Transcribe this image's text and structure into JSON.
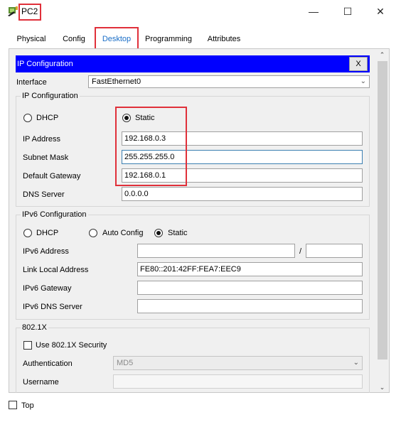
{
  "window": {
    "title": "PC2",
    "minimize_glyph": "—",
    "maximize_glyph": "☐",
    "close_glyph": "✕"
  },
  "tabs": [
    {
      "label": "Physical"
    },
    {
      "label": "Config"
    },
    {
      "label": "Desktop",
      "active": true
    },
    {
      "label": "Programming"
    },
    {
      "label": "Attributes"
    }
  ],
  "panel": {
    "header": "IP Configuration",
    "close_label": "X",
    "interface_label": "Interface",
    "interface_value": "FastEthernet0"
  },
  "ipv4": {
    "group_title": "IP Configuration",
    "dhcp_label": "DHCP",
    "static_label": "Static",
    "mode": "Static",
    "fields": [
      {
        "label": "IP Address",
        "value": "192.168.0.3"
      },
      {
        "label": "Subnet Mask",
        "value": "255.255.255.0"
      },
      {
        "label": "Default Gateway",
        "value": "192.168.0.1"
      },
      {
        "label": "DNS Server",
        "value": "0.0.0.0"
      }
    ]
  },
  "ipv6": {
    "group_title": "IPv6 Configuration",
    "dhcp_label": "DHCP",
    "auto_label": "Auto Config",
    "static_label": "Static",
    "mode": "Static",
    "address_label": "IPv6 Address",
    "address_value": "",
    "prefix_separator": "/",
    "prefix_value": "",
    "link_local_label": "Link Local Address",
    "link_local_value": "FE80::201:42FF:FEA7:EEC9",
    "gateway_label": "IPv6 Gateway",
    "gateway_value": "",
    "dns_label": "IPv6 DNS Server",
    "dns_value": ""
  },
  "dot1x": {
    "group_title": "802.1X",
    "use_security_label": "Use 802.1X Security",
    "use_security_checked": false,
    "auth_label": "Authentication",
    "auth_value": "MD5",
    "username_label": "Username"
  },
  "footer": {
    "top_label": "Top",
    "top_checked": false
  },
  "colors": {
    "header_blue": "#0000ff",
    "active_tab": "#1a6ec7",
    "highlight": "#e0303a"
  }
}
